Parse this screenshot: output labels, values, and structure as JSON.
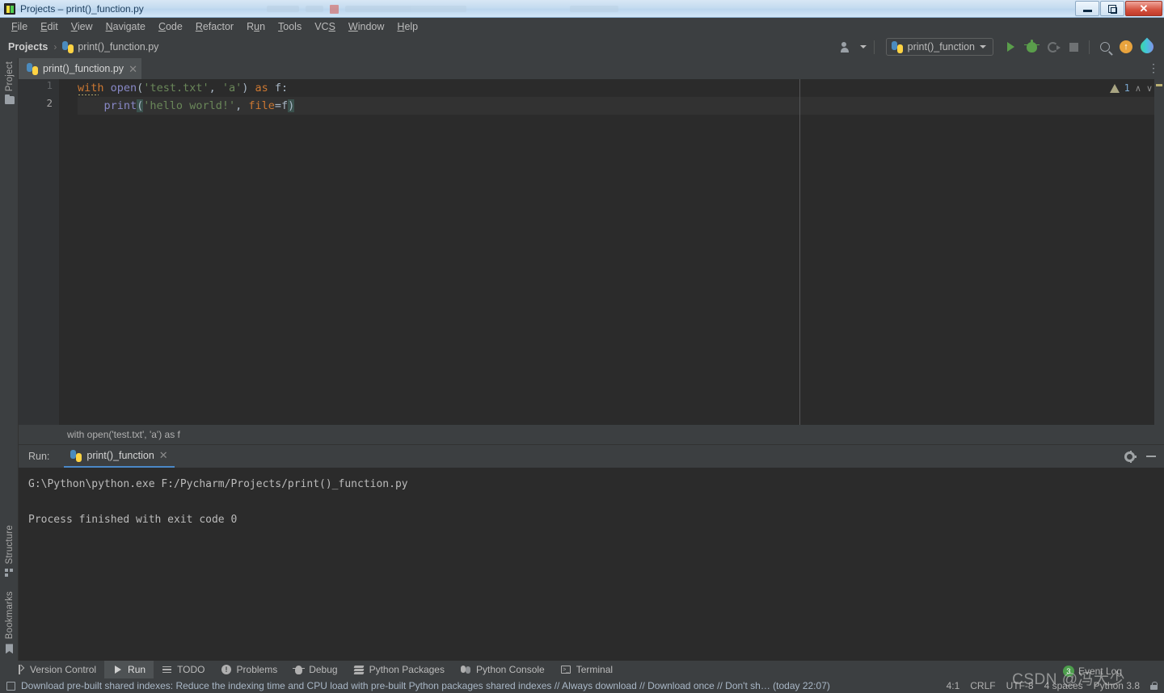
{
  "window": {
    "title": "Projects – print()_function.py",
    "icon": "pycharm-logo-icon",
    "minimize_label": "Minimize",
    "maximize_label": "Restore",
    "close_label": "✕"
  },
  "menu": {
    "items": [
      {
        "pre": "",
        "mn": "F",
        "post": "ile"
      },
      {
        "pre": "",
        "mn": "E",
        "post": "dit"
      },
      {
        "pre": "",
        "mn": "V",
        "post": "iew"
      },
      {
        "pre": "",
        "mn": "N",
        "post": "avigate"
      },
      {
        "pre": "",
        "mn": "C",
        "post": "ode"
      },
      {
        "pre": "",
        "mn": "R",
        "post": "efactor"
      },
      {
        "pre": "R",
        "mn": "u",
        "post": "n"
      },
      {
        "pre": "",
        "mn": "T",
        "post": "ools"
      },
      {
        "pre": "VC",
        "mn": "S",
        "post": ""
      },
      {
        "pre": "",
        "mn": "W",
        "post": "indow"
      },
      {
        "pre": "",
        "mn": "H",
        "post": "elp"
      }
    ]
  },
  "navbar": {
    "project": "Projects",
    "separator": "›",
    "file": "print()_function.py",
    "run_config": "print()_function",
    "icons": {
      "people": "people-icon",
      "run": "run-icon",
      "debug": "debug-icon",
      "profile": "profile-icon",
      "stop": "stop-icon",
      "search": "search-everywhere-icon",
      "update": "update-icon",
      "ai": "ai-assistant-icon"
    }
  },
  "left_tools": [
    {
      "label": "Project",
      "icon": "folder-icon"
    },
    {
      "label": "Structure",
      "icon": "structure-icon"
    },
    {
      "label": "Bookmarks",
      "icon": "bookmark-icon"
    }
  ],
  "editor": {
    "tab": {
      "label": "print()_function.py",
      "close": "✕",
      "icon": "python-file-icon"
    },
    "overflow": "⋮",
    "line_numbers": [
      "1",
      "2"
    ],
    "code_lines": [
      {
        "number": "1",
        "tokens": [
          {
            "text": "with",
            "cls": "k-kw"
          },
          {
            "text": " ",
            "cls": "k-def"
          },
          {
            "text": "open",
            "cls": "k-fn"
          },
          {
            "text": "(",
            "cls": "k-def"
          },
          {
            "text": "'test.txt'",
            "cls": "k-str"
          },
          {
            "text": ", ",
            "cls": "k-def"
          },
          {
            "text": "'a'",
            "cls": "k-str"
          },
          {
            "text": ")",
            "cls": "k-def"
          },
          {
            "text": " ",
            "cls": "k-def"
          },
          {
            "text": "as",
            "cls": "k-kw"
          },
          {
            "text": " f:",
            "cls": "k-def"
          }
        ]
      },
      {
        "number": "2",
        "tokens": [
          {
            "text": "    ",
            "cls": "k-def"
          },
          {
            "text": "print",
            "cls": "k-fn"
          },
          {
            "text": "(",
            "cls": "k-brace"
          },
          {
            "text": "'hello world!'",
            "cls": "k-str"
          },
          {
            "text": ", ",
            "cls": "k-def"
          },
          {
            "text": "file",
            "cls": "k-param"
          },
          {
            "text": "=",
            "cls": "k-def"
          },
          {
            "text": "f",
            "cls": "k-def"
          },
          {
            "text": ")",
            "cls": "k-brace"
          }
        ]
      }
    ],
    "inspection": {
      "warning_count": "1",
      "warning_icon": "warning-triangle-icon",
      "prev": "∧",
      "next": "∨"
    },
    "breadcrumb": "with open('test.txt', 'a') as f"
  },
  "run_window": {
    "label": "Run:",
    "tab_label": "print()_function",
    "tab_close": "✕",
    "tab_icon": "python-config-icon",
    "settings_icon": "gear-icon",
    "minimize_icon": "minimize-icon",
    "console_lines": [
      "G:\\Python\\python.exe F:/Pycharm/Projects/print()_function.py",
      "",
      "Process finished with exit code 0"
    ]
  },
  "bottom_tools": [
    {
      "label": "Version Control",
      "icon": "branch-icon",
      "active": false
    },
    {
      "label": "Run",
      "icon": "run-icon",
      "active": true
    },
    {
      "label": "TODO",
      "icon": "todo-icon",
      "active": false
    },
    {
      "label": "Problems",
      "icon": "problems-icon",
      "active": false
    },
    {
      "label": "Debug",
      "icon": "debug-icon",
      "active": false
    },
    {
      "label": "Python Packages",
      "icon": "packages-icon",
      "active": false
    },
    {
      "label": "Python Console",
      "icon": "python-console-icon",
      "active": false
    },
    {
      "label": "Terminal",
      "icon": "terminal-icon",
      "active": false
    }
  ],
  "status_bar": {
    "notification_icon": "notification-icon",
    "notification": "Download pre-built shared indexes: Reduce the indexing time and CPU load with pre-built Python packages shared indexes // Always download // Download once // Don't sh… (today 22:07)",
    "caret_position": "4:1",
    "line_separator": "CRLF",
    "encoding": "UTF-8",
    "indent": "4 spaces",
    "interpreter": "Python 3.8",
    "lock_icon": "lock-icon"
  },
  "event_log": {
    "badge": "3",
    "label": "Event Log"
  },
  "watermark": "CSDN @冯大少",
  "colors": {
    "ide_chrome": "#3c3f41",
    "editor_bg": "#2b2b2b",
    "gutter_bg": "#313335",
    "accent_blue": "#4a88c7",
    "keyword_orange": "#cc7832",
    "string_green": "#6a8759",
    "function_purple": "#8888c6",
    "default_text": "#a9b7c6",
    "run_green": "#5a9e4b",
    "warning_yellow": "#bbb072",
    "badge_green": "#4c9e4c"
  }
}
